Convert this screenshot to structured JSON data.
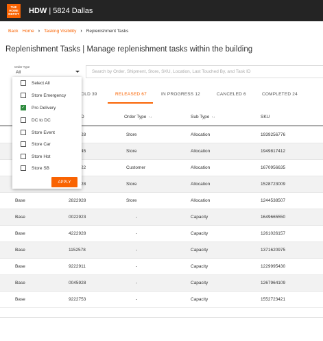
{
  "header": {
    "logo_icon": "home-depot-logo",
    "logo_text": "THE HOME DEPOT",
    "brand": "HDW",
    "separator": "|",
    "store": "5824 Dallas"
  },
  "breadcrumb": {
    "items": [
      "Back",
      "Home",
      "Tasking Visibility",
      "Replenishment Tasks"
    ]
  },
  "page": {
    "title": "Replenishment Tasks | Manage replenishment tasks within the building"
  },
  "filter": {
    "label": "Order Type",
    "value": "All",
    "options": [
      {
        "label": "Select All",
        "checked": false
      },
      {
        "label": "Store Emergency",
        "checked": false
      },
      {
        "label": "Pro Delivery",
        "checked": true
      },
      {
        "label": "DC to DC",
        "checked": false
      },
      {
        "label": "Store Event",
        "checked": false
      },
      {
        "label": "Store Car",
        "checked": false
      },
      {
        "label": "Store Hot",
        "checked": false
      },
      {
        "label": "Store SB",
        "checked": false
      }
    ],
    "apply_label": "APPLY"
  },
  "search": {
    "placeholder": "Search by Order, Shipment, Store, SKU, Location, Last Touched By, and Task ID"
  },
  "tabs": [
    {
      "label": "OLD 39",
      "active": false
    },
    {
      "label": "RELEASED 67",
      "active": true
    },
    {
      "label": "IN PROGRESS 12",
      "active": false
    },
    {
      "label": "CANCELED 6",
      "active": false
    },
    {
      "label": "COMPLETED 24",
      "active": false
    }
  ],
  "table": {
    "columns": [
      "D",
      "Order Type",
      "Sub Type",
      "SKU"
    ],
    "sort_glyph": "↑↓",
    "rows": [
      {
        "type": "",
        "id": "28",
        "order_type": "Store",
        "sub_type": "Allocation",
        "sku": "1939256776"
      },
      {
        "type": "",
        "id": "45",
        "order_type": "Store",
        "sub_type": "Allocation",
        "sku": "1949817412"
      },
      {
        "type": "",
        "id": "22",
        "order_type": "Customer",
        "sub_type": "Allocation",
        "sku": "1670956635"
      },
      {
        "type": "",
        "id": "28",
        "order_type": "Store",
        "sub_type": "Allocation",
        "sku": "1528723009"
      },
      {
        "type": "Base",
        "id": "2822928",
        "order_type": "Store",
        "sub_type": "Allocation",
        "sku": "1244538507"
      },
      {
        "type": "Base",
        "id": "0022923",
        "order_type": "-",
        "sub_type": "Capacity",
        "sku": "1649665550"
      },
      {
        "type": "Base",
        "id": "4222928",
        "order_type": "-",
        "sub_type": "Capacity",
        "sku": "1261026157"
      },
      {
        "type": "Base",
        "id": "1152578",
        "order_type": "-",
        "sub_type": "Capacity",
        "sku": "1371620975"
      },
      {
        "type": "Base",
        "id": "9222911",
        "order_type": "-",
        "sub_type": "Capacity",
        "sku": "1229995430"
      },
      {
        "type": "Base",
        "id": "0045928",
        "order_type": "-",
        "sub_type": "Capacity",
        "sku": "1267964109"
      },
      {
        "type": "Base",
        "id": "9222753",
        "order_type": "-",
        "sub_type": "Capacity",
        "sku": "1552723421"
      }
    ]
  },
  "colors": {
    "accent": "#f96302",
    "topbar": "#242424",
    "checked": "#2e8b3e"
  }
}
